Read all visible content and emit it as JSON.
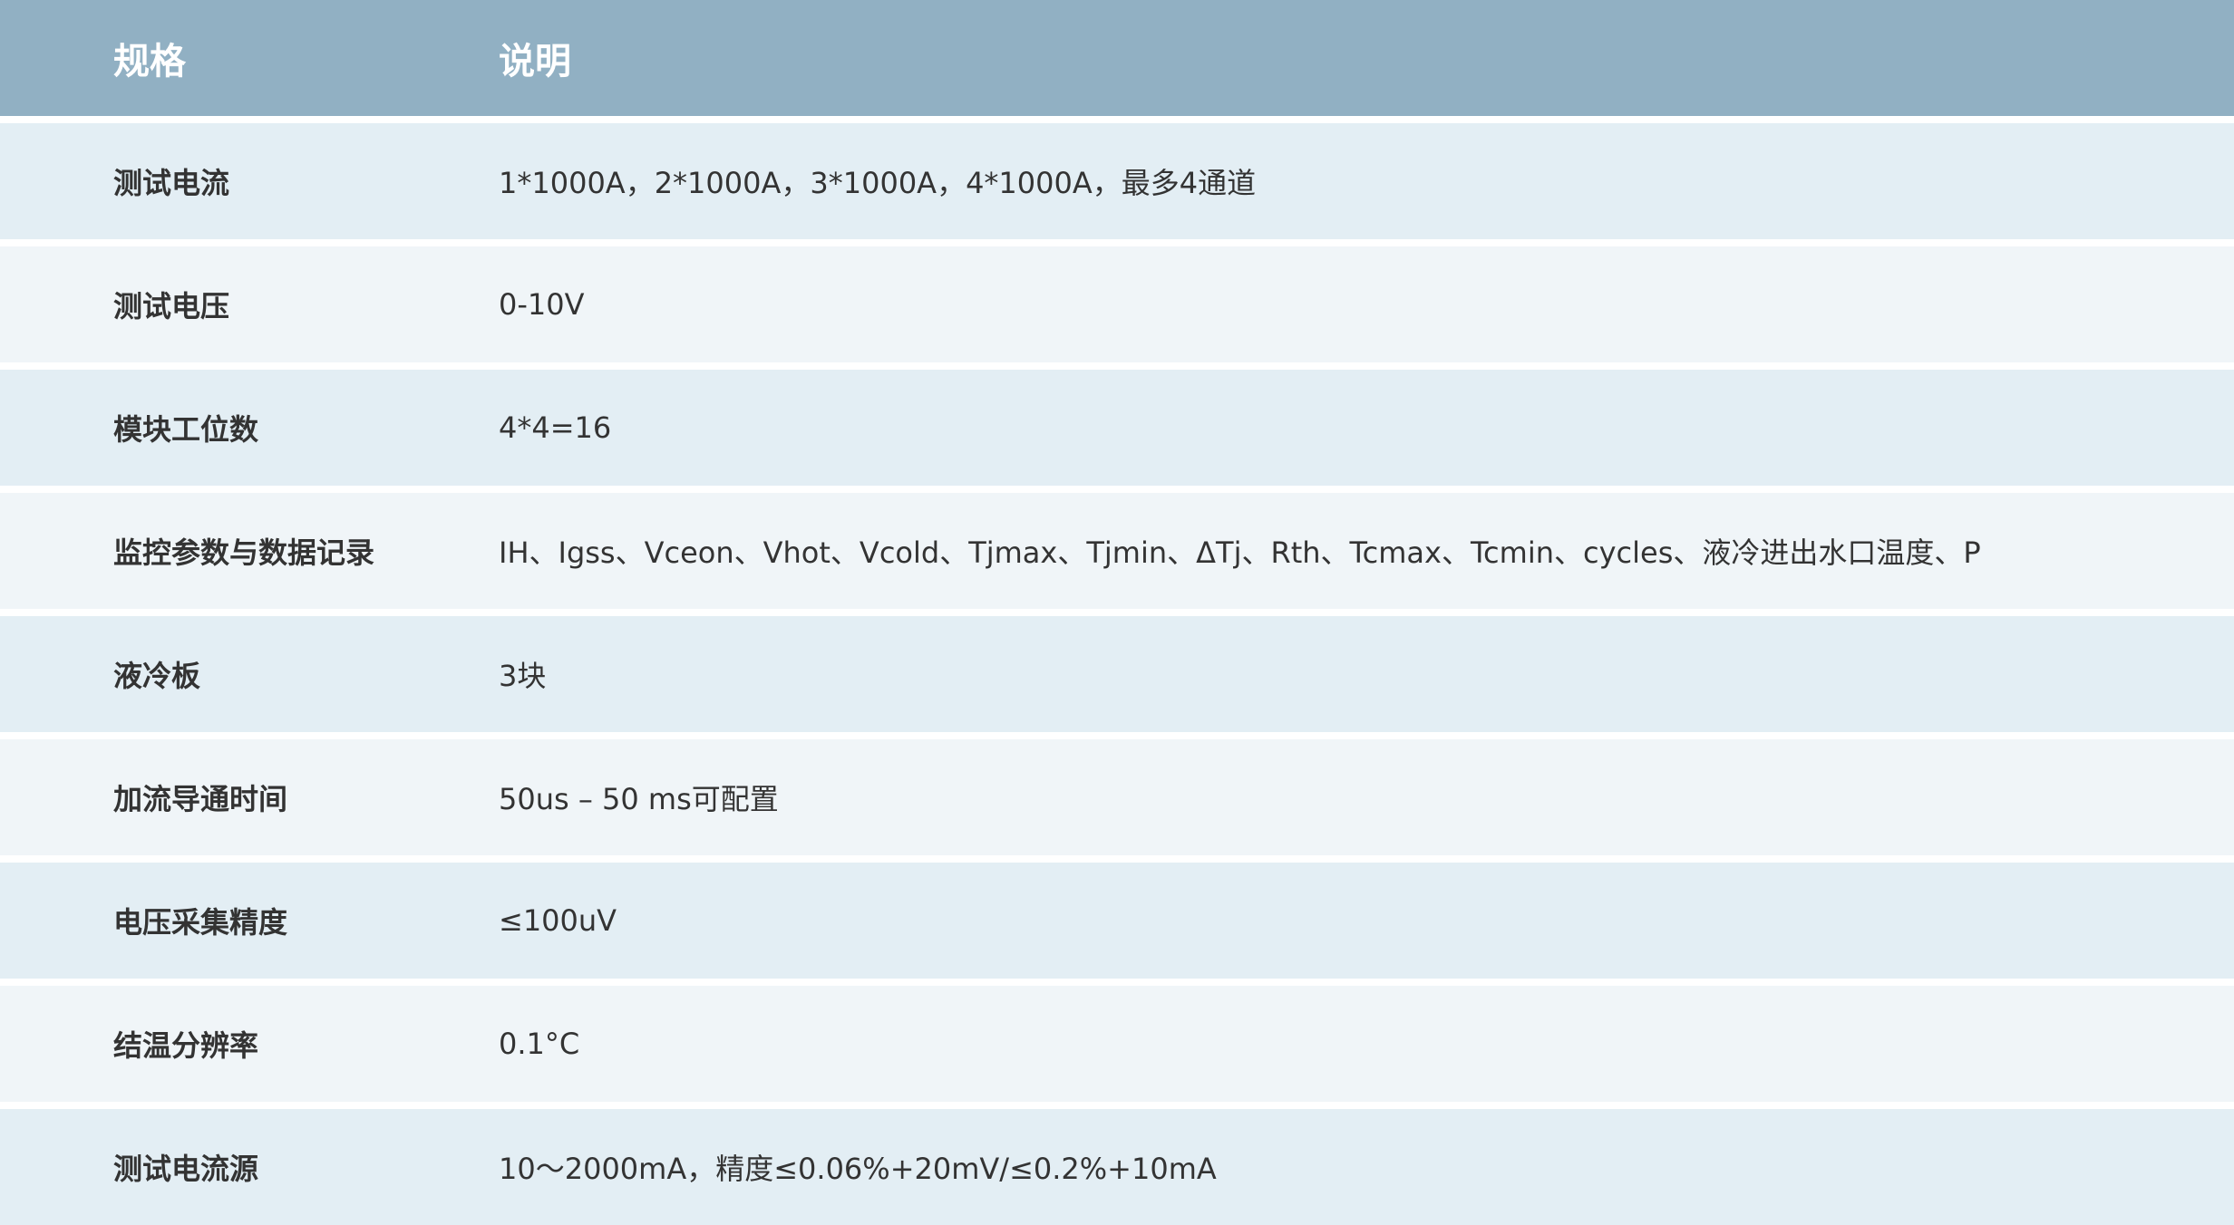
{
  "header": {
    "spec": "规格",
    "description": "说明"
  },
  "rows": [
    {
      "spec": "测试电流",
      "description": "1*1000A，2*1000A，3*1000A，4*1000A，最多4通道"
    },
    {
      "spec": "测试电压",
      "description": "0-10V"
    },
    {
      "spec": "模块工位数",
      "description": "4*4=16"
    },
    {
      "spec": "监控参数与数据记录",
      "description": "IH、Igss、Vceon、Vhot、Vcold、Tjmax、Tjmin、ΔTj、Rth、Tcmax、Tcmin、cycles、液冷进出水口温度、P"
    },
    {
      "spec": "液冷板",
      "description": "3块"
    },
    {
      "spec": "加流导通时间",
      "description": "50us – 50 ms可配置"
    },
    {
      "spec": "电压采集精度",
      "description": "≤100uV"
    },
    {
      "spec": "结温分辨率",
      "description": "0.1°C"
    },
    {
      "spec": "测试电流源",
      "description": "10～2000mA，精度≤0.06%+20mV/≤0.2%+10mA"
    }
  ],
  "colors": {
    "header_bg": "#91b0c3",
    "row_odd_bg": "#e3eef4",
    "row_even_bg": "#f0f5f8",
    "header_text": "#ffffff",
    "body_text": "#333333"
  }
}
